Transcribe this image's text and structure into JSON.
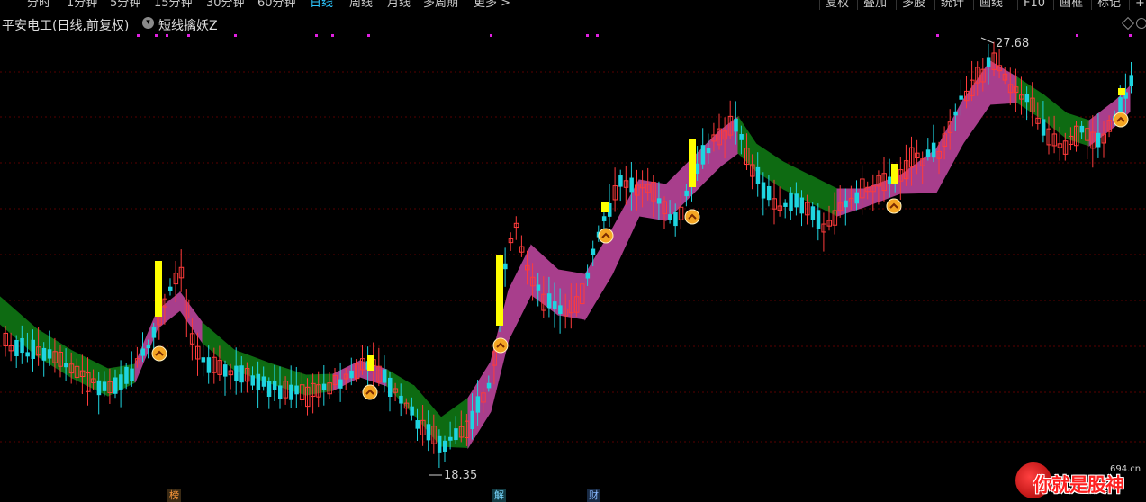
{
  "toolbar": {
    "periods": [
      "分时",
      "1分钟",
      "5分钟",
      "15分钟",
      "30分钟",
      "60分钟",
      "日线",
      "周线",
      "月线",
      "多周期",
      "更多 >"
    ],
    "active_period": "日线",
    "right_items": [
      "复权",
      "叠加",
      "多股",
      "统计",
      "画线",
      "F10",
      "画框",
      "标记",
      "+自"
    ]
  },
  "header": {
    "stock_title": "平安电工(日线,前复权)",
    "indicator_name": "短线擒妖Z"
  },
  "price_labels": {
    "high": "27.68",
    "low": "18.35"
  },
  "event_badges": [
    "榜",
    "解",
    "财"
  ],
  "watermark": {
    "text": "你就是股神",
    "site": "694.cn"
  },
  "colors": {
    "background": "#000000",
    "up_candle": "#ff3b3b",
    "down_candle": "#1fd4e0",
    "signal_bar": "#ffff00",
    "ribbon_up": "#a83e8c",
    "ribbon_down": "#0e6b12",
    "grid": "#5a0000",
    "marker": "#e020e0",
    "signal_icon": "#f5a623",
    "active_tab": "#2ec7ff"
  },
  "chart_data": {
    "type": "candlestick",
    "ylim": [
      18.35,
      27.68
    ],
    "high": 27.68,
    "low": 18.35
  }
}
